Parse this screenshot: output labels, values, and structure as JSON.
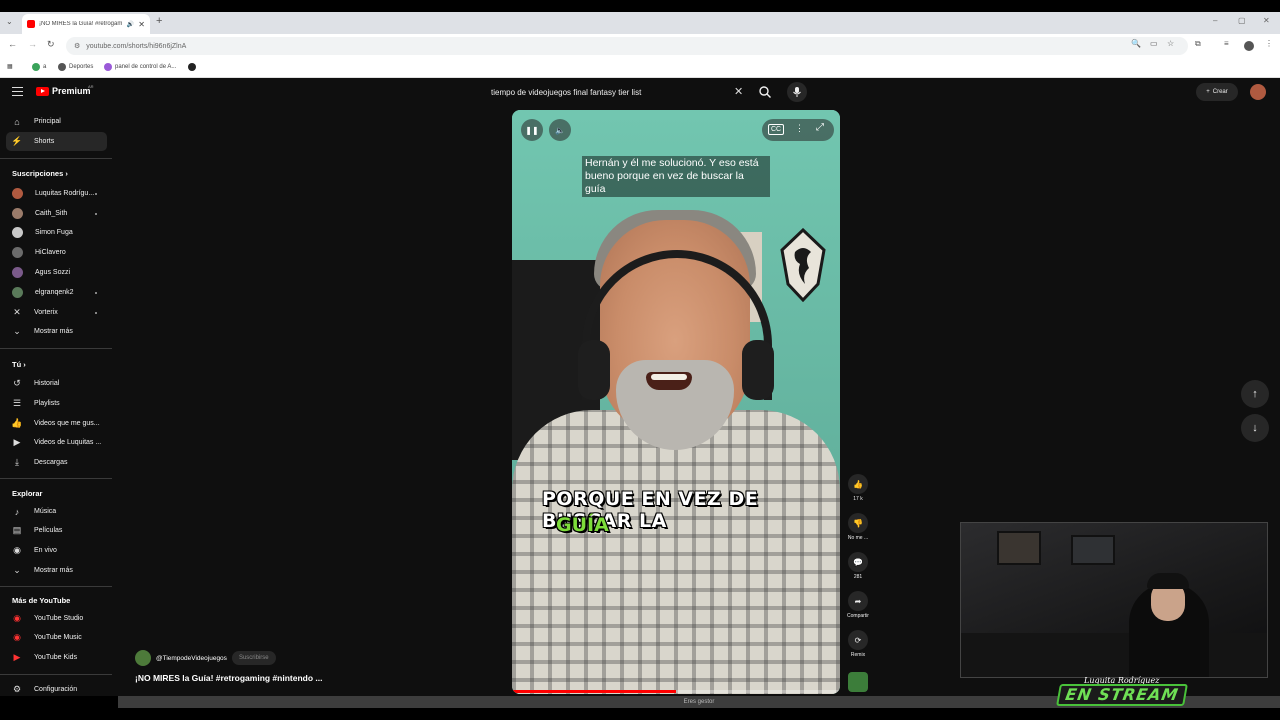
{
  "browser": {
    "tab_title": "¡NO MIRES la Guía! #retrogam",
    "new_tab": "+",
    "url": "youtube.com/shorts/hi96n6jZlnA",
    "bookmarks": [
      "a",
      "Deportes",
      "panel de control de A..."
    ]
  },
  "header": {
    "logo_text": "Premium",
    "logo_badge": "AR",
    "search_value": "tiempo de videojuegos final fantasy tier list",
    "create_label": "Crear"
  },
  "sidebar": {
    "main": [
      {
        "label": "Principal",
        "icon": "home-icon"
      },
      {
        "label": "Shorts",
        "icon": "shorts-icon",
        "active": true
      }
    ],
    "subs_title": "Suscripciones",
    "subs": [
      {
        "label": "Luquitas Rodrígu...",
        "color": "#b05a40",
        "dot": true
      },
      {
        "label": "Caith_Sith",
        "color": "#9a7b6a",
        "dot": true
      },
      {
        "label": "Simon Fuga",
        "color": "#c8c8c8",
        "dot": false
      },
      {
        "label": "HiClavero",
        "color": "#6b6b6b",
        "dot": false
      },
      {
        "label": "Agus Sozzi",
        "color": "#7a5a8a",
        "dot": false
      },
      {
        "label": "elgranqenk2",
        "color": "#5a7a5a",
        "dot": true
      },
      {
        "label": "Vorterix",
        "color": "#222222",
        "dot": true
      }
    ],
    "subs_more": "Mostrar más",
    "you_title": "Tú",
    "you": [
      "Historial",
      "Playlists",
      "Videos que me gus...",
      "Videos de Luquitas ...",
      "Descargas"
    ],
    "explore_title": "Explorar",
    "explore": [
      "Música",
      "Películas",
      "En vivo",
      "Mostrar más"
    ],
    "more_title": "Más de YouTube",
    "more": [
      "YouTube Studio",
      "YouTube Music",
      "YouTube Kids"
    ],
    "settings": "Configuración"
  },
  "video": {
    "caption_top": "Hernán y él me solucionó. Y eso está bueno porque en vez de buscar la guía",
    "caption_big_1": "PORQUE EN VEZ DE BUSCAR LA",
    "caption_big_2": "GUÍA",
    "progress": 0.5
  },
  "actions": {
    "likes": "17 k",
    "dislike": "No me ...",
    "comments": "281",
    "share": "Compartir",
    "remix": "Remix"
  },
  "channel": {
    "handle": "@TiempodeVideojuegos",
    "subscribe": "Suscribirse",
    "title": "¡NO MIRES la Guía! #retrogaming #nintendo ..."
  },
  "status_text": "Eres gestor",
  "overlay": {
    "name": "Luquita Rodríguez",
    "big": "EN STREAM"
  }
}
